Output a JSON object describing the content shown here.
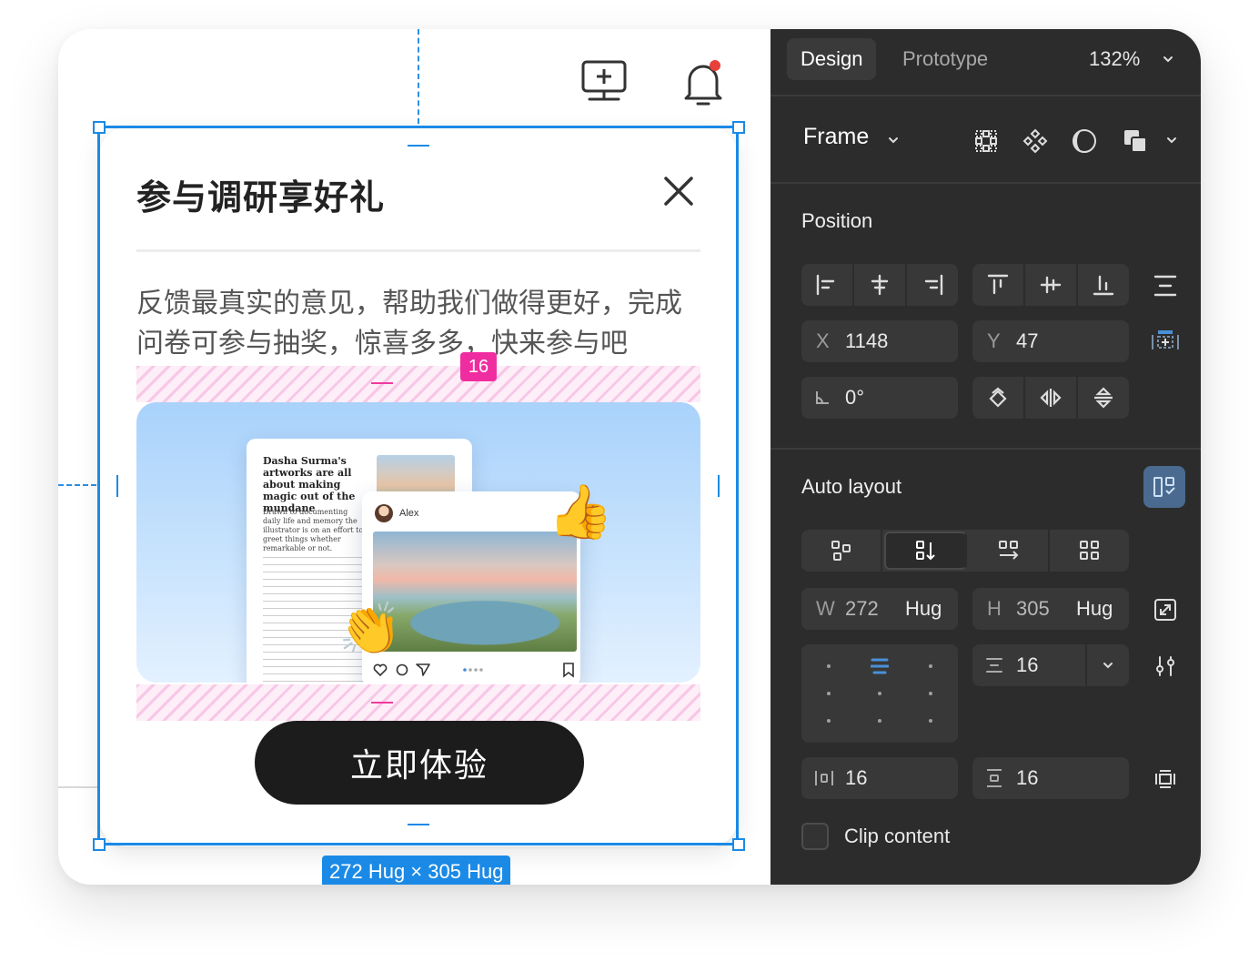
{
  "canvas": {
    "toolbar": {
      "add_icon": "monitor-plus-icon",
      "notification_icon": "bell-icon",
      "notification_dot_color": "#e8413b"
    },
    "card": {
      "title": "参与调研享好礼",
      "description": "反馈最真实的意见，帮助我们做得更好，完成问卷可参与抽奖，惊喜多多，快来参与吧",
      "spacing_badge": "16",
      "hero": {
        "doc_title": "Dasha Surma's artworks are all about making magic out of the mundane",
        "doc_subtitle": "Drawn to documenting daily life and memory the illustrator is on an effort to greet things whether remarkable or not.",
        "post_author": "Alex"
      },
      "cta_label": "立即体验"
    },
    "selection": {
      "size_label": "272 Hug × 305 Hug",
      "color": "#1b8ae6"
    }
  },
  "panel": {
    "tabs": [
      {
        "label": "Design",
        "active": true
      },
      {
        "label": "Prototype",
        "active": false
      }
    ],
    "zoom": "132%",
    "frame": {
      "label": "Frame"
    },
    "position": {
      "title": "Position",
      "x_label": "X",
      "x": "1148",
      "y_label": "Y",
      "y": "47",
      "rotation": "0°"
    },
    "auto_layout": {
      "title": "Auto layout",
      "w_label": "W",
      "w": "272",
      "w_mode": "Hug",
      "h_label": "H",
      "h": "305",
      "h_mode": "Hug",
      "gap": "16",
      "padding_h": "16",
      "padding_v": "16",
      "clip_content": "Clip content"
    }
  }
}
